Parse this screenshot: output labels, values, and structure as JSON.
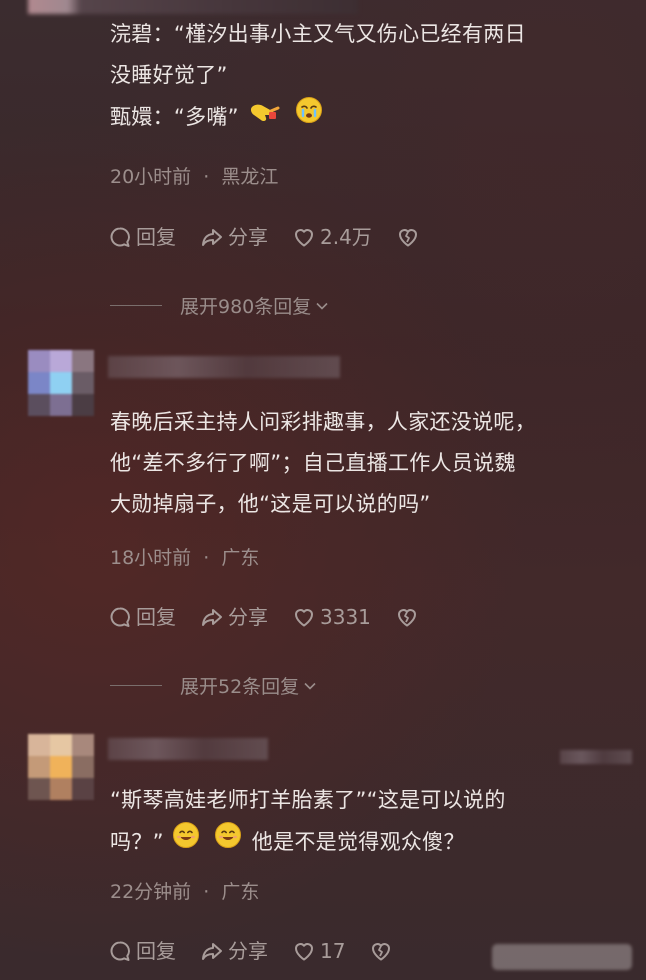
{
  "comments": [
    {
      "lines": [
        "浣碧：“槿汐出事小主又气又伤心已经有两日",
        "没睡好觉了”",
        "甄嬛：“多嘴”"
      ],
      "emoji_names": [
        "pointing-finger-emoji",
        "crying-face-emoji"
      ],
      "time": "20小时前",
      "location": "黑龙江",
      "reply_label": "回复",
      "share_label": "分享",
      "like_count": "2.4万",
      "expand_label": "展开980条回复"
    },
    {
      "lines": [
        "春晚后采主持人问彩排趣事，人家还没说呢，",
        "他“差不多行了啊”；自己直播工作人员说魏",
        "大勋掉扇子，他“这是可以说的吗”"
      ],
      "time": "18小时前",
      "location": "广东",
      "reply_label": "回复",
      "share_label": "分享",
      "like_count": "3331",
      "expand_label": "展开52条回复"
    },
    {
      "lines": [
        "“斯琴高娃老师打羊胎素了”“这是可以说的",
        "吗？”",
        "他是不是觉得观众傻？"
      ],
      "emoji_names": [
        "smiling-face-emoji",
        "smiling-face-emoji"
      ],
      "time": "22分钟前",
      "location": "广东",
      "reply_label": "回复",
      "share_label": "分享",
      "like_count": "17"
    }
  ],
  "separator": "·",
  "colors": {
    "text": "#ece6e4",
    "meta": "#9c8e8c",
    "action": "#a89c9a",
    "emoji_yellow": "#f4c82e"
  }
}
